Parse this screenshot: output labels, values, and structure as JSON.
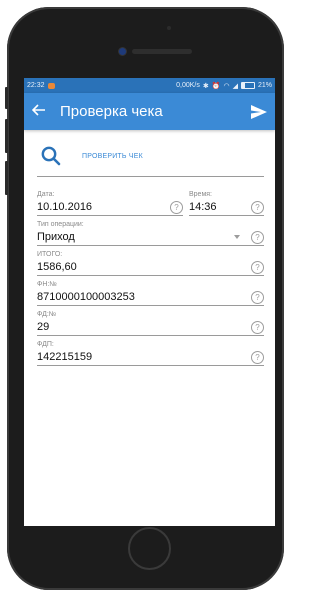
{
  "statusbar": {
    "time": "22:32",
    "net_speed": "0,00K/s",
    "battery": "21%",
    "battery_fill": 0.21
  },
  "appbar": {
    "title": "Проверка чека"
  },
  "check_action": {
    "label": "ПРОВЕРИТЬ ЧЕК"
  },
  "fields": {
    "date": {
      "label": "Дата:",
      "value": "10.10.2016"
    },
    "time": {
      "label": "Время:",
      "value": "14:36"
    },
    "operation_type": {
      "label": "Тип операции:",
      "value": "Приход"
    },
    "total": {
      "label": "ИТОГО:",
      "value": "1586,60"
    },
    "fn": {
      "label": "ФН:№",
      "value": "8710000100003253"
    },
    "fd": {
      "label": "ФД:№",
      "value": "29"
    },
    "fdp": {
      "label": "ФДП:",
      "value": "142215159"
    }
  },
  "icons": {
    "back": "arrow-left",
    "send": "send",
    "search": "magnifier",
    "help": "question-circle"
  },
  "colors": {
    "appbar": "#3b8ad6",
    "statusbar": "#2a72b8",
    "accent": "#3b8ad6"
  }
}
